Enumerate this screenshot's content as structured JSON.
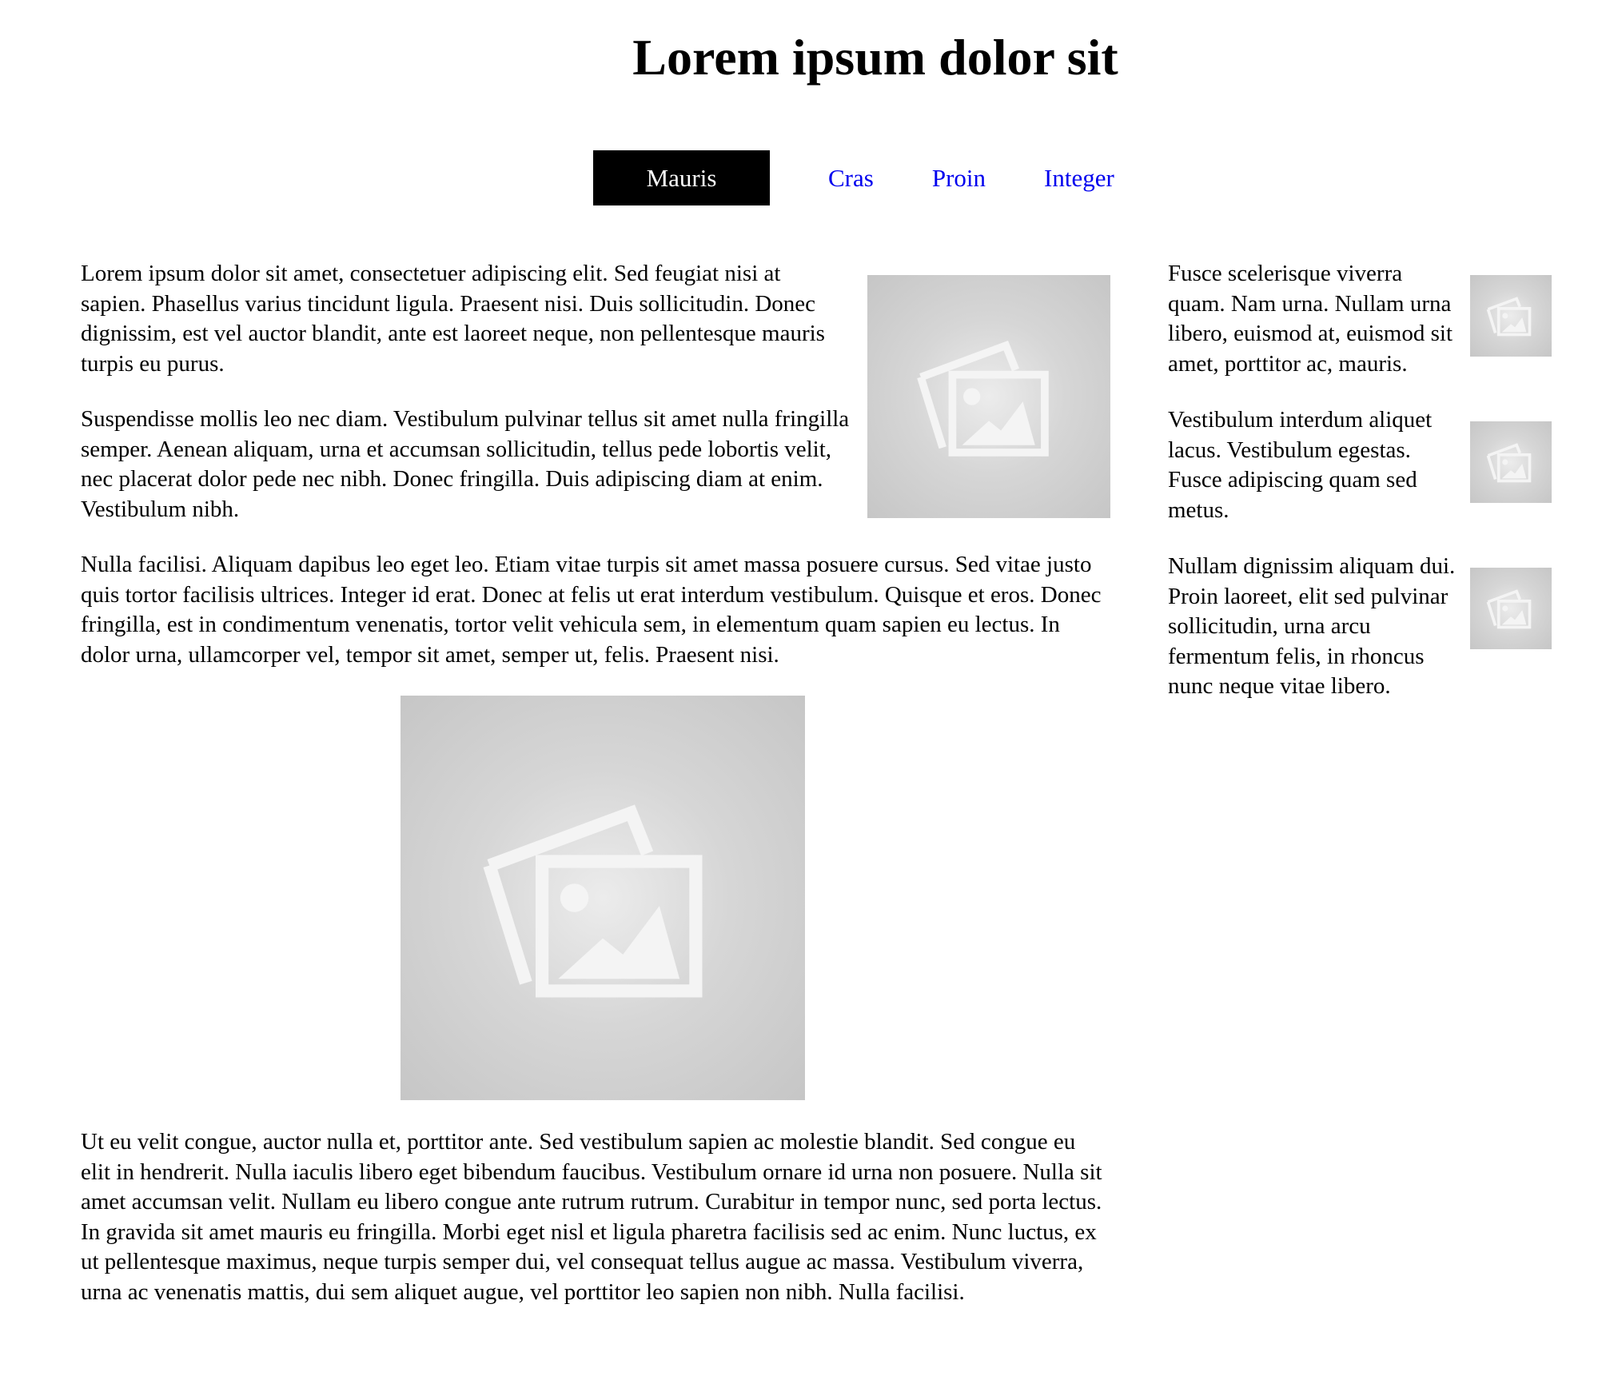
{
  "header": {
    "title": "Lorem ipsum dolor sit"
  },
  "nav": {
    "items": [
      {
        "label": "Mauris",
        "active": true
      },
      {
        "label": "Cras",
        "active": false
      },
      {
        "label": "Proin",
        "active": false
      },
      {
        "label": "Integer",
        "active": false
      }
    ]
  },
  "main": {
    "paragraphs": [
      "Lorem ipsum dolor sit amet, consectetuer adipiscing elit. Sed feugiat nisi at sapien. Phasellus varius tincidunt ligula. Praesent nisi. Duis sollicitudin. Donec dignissim, est vel auctor blandit, ante est laoreet neque, non pellentesque mauris turpis eu purus.",
      "Suspendisse mollis leo nec diam. Vestibulum pulvinar tellus sit amet nulla fringilla semper. Aenean aliquam, urna et accumsan sollicitudin, tellus pede lobortis velit, nec placerat dolor pede nec nibh. Donec fringilla. Duis adipiscing diam at enim. Vestibulum nibh.",
      "Nulla facilisi. Aliquam dapibus leo eget leo. Etiam vitae turpis sit amet massa posuere cursus. Sed vitae justo quis tortor facilisis ultrices. Integer id erat. Donec at felis ut erat interdum vestibulum. Quisque et eros. Donec fringilla, est in condimentum venenatis, tortor velit vehicula sem, in elementum quam sapien eu lectus. In dolor urna, ullamcorper vel, tempor sit amet, semper ut, felis. Praesent nisi.",
      "Ut eu velit congue, auctor nulla et, porttitor ante. Sed vestibulum sapien ac molestie blandit. Sed congue eu elit in hendrerit. Nulla iaculis libero eget bibendum faucibus. Vestibulum ornare id urna non posuere. Nulla sit amet accumsan velit. Nullam eu libero congue ante rutrum rutrum. Curabitur in tempor nunc, sed porta lectus. In gravida sit amet mauris eu fringilla. Morbi eget nisl et ligula pharetra facilisis sed ac enim. Nunc luctus, ex ut pellentesque maximus, neque turpis semper dui, vel consequat tellus augue ac massa. Vestibulum viverra, urna ac venenatis mattis, dui sem aliquet augue, vel porttitor leo sapien non nibh. Nulla facilisi."
    ]
  },
  "sidebar": {
    "items": [
      {
        "text": "Fusce scelerisque viverra quam. Nam urna. Nullam urna libero, euismod at, euismod sit amet, porttitor ac, mauris."
      },
      {
        "text": "Vestibulum interdum aliquet lacus. Vestibulum egestas. Fusce adipiscing quam sed metus."
      },
      {
        "text": "Nullam dignissim aliquam dui. Proin laoreet, elit sed pulvinar sollicitudin, urna arcu fermentum felis, in rhoncus nunc neque vitae libero."
      }
    ]
  },
  "theme": {
    "link_color": "#0000ee",
    "active_nav_bg": "#000000",
    "active_nav_text": "#ffffff",
    "placeholder_bg": "#c8c8c8",
    "placeholder_icon": "#f5f5f5"
  },
  "icons": {
    "image_placeholder": "image-placeholder-icon"
  }
}
